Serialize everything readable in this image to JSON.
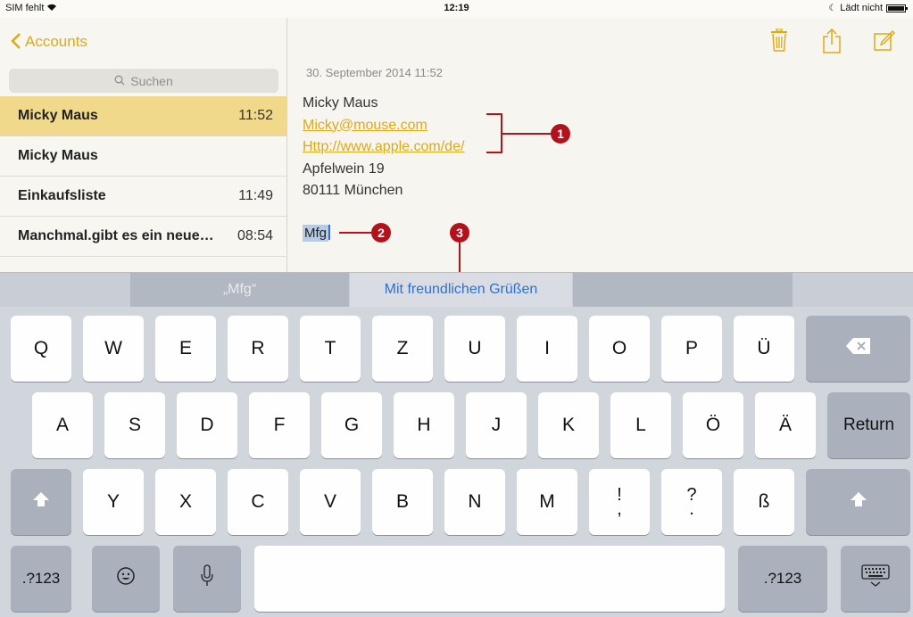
{
  "status_bar": {
    "carrier": "SIM fehlt",
    "time": "12:19",
    "battery_label": "Lädt nicht"
  },
  "sidebar": {
    "back_label": "Accounts",
    "search_placeholder": "Suchen",
    "notes": [
      {
        "title": "Micky Maus",
        "time": "11:52",
        "selected": true
      },
      {
        "title": "Micky Maus",
        "time": ""
      },
      {
        "title": "Einkaufsliste",
        "time": "11:49"
      },
      {
        "title": "Manchmal.gibt es ein neue…",
        "time": "08:54"
      }
    ]
  },
  "note": {
    "date": "30. September 2014 11:52",
    "lines": [
      "Micky Maus",
      "Micky@mouse.com",
      "Http://www.apple.com/de/",
      "Apfelwein 19",
      "80111 München"
    ],
    "selected_word": "Mfg"
  },
  "annotations": {
    "one": "1",
    "two": "2",
    "three": "3"
  },
  "quicktype": {
    "left": "„Mfg“",
    "center": "Mit freundlichen Grüßen",
    "right": ""
  },
  "keyboard": {
    "row1": [
      "Q",
      "W",
      "E",
      "R",
      "T",
      "Z",
      "U",
      "I",
      "O",
      "P",
      "Ü"
    ],
    "row2": [
      "A",
      "S",
      "D",
      "F",
      "G",
      "H",
      "J",
      "K",
      "L",
      "Ö",
      "Ä"
    ],
    "return_label": "Return",
    "row3": [
      "Y",
      "X",
      "C",
      "V",
      "B",
      "N",
      "M"
    ],
    "row3_punct": [
      [
        "!",
        ","
      ],
      [
        "?",
        "."
      ]
    ],
    "sz": "ß",
    "numbers_label": ".?123"
  },
  "colors": {
    "accent": "#e0a914",
    "selection": "#f1d98c",
    "annotation": "#b2121b",
    "suggestion": "#2f6fd0"
  }
}
